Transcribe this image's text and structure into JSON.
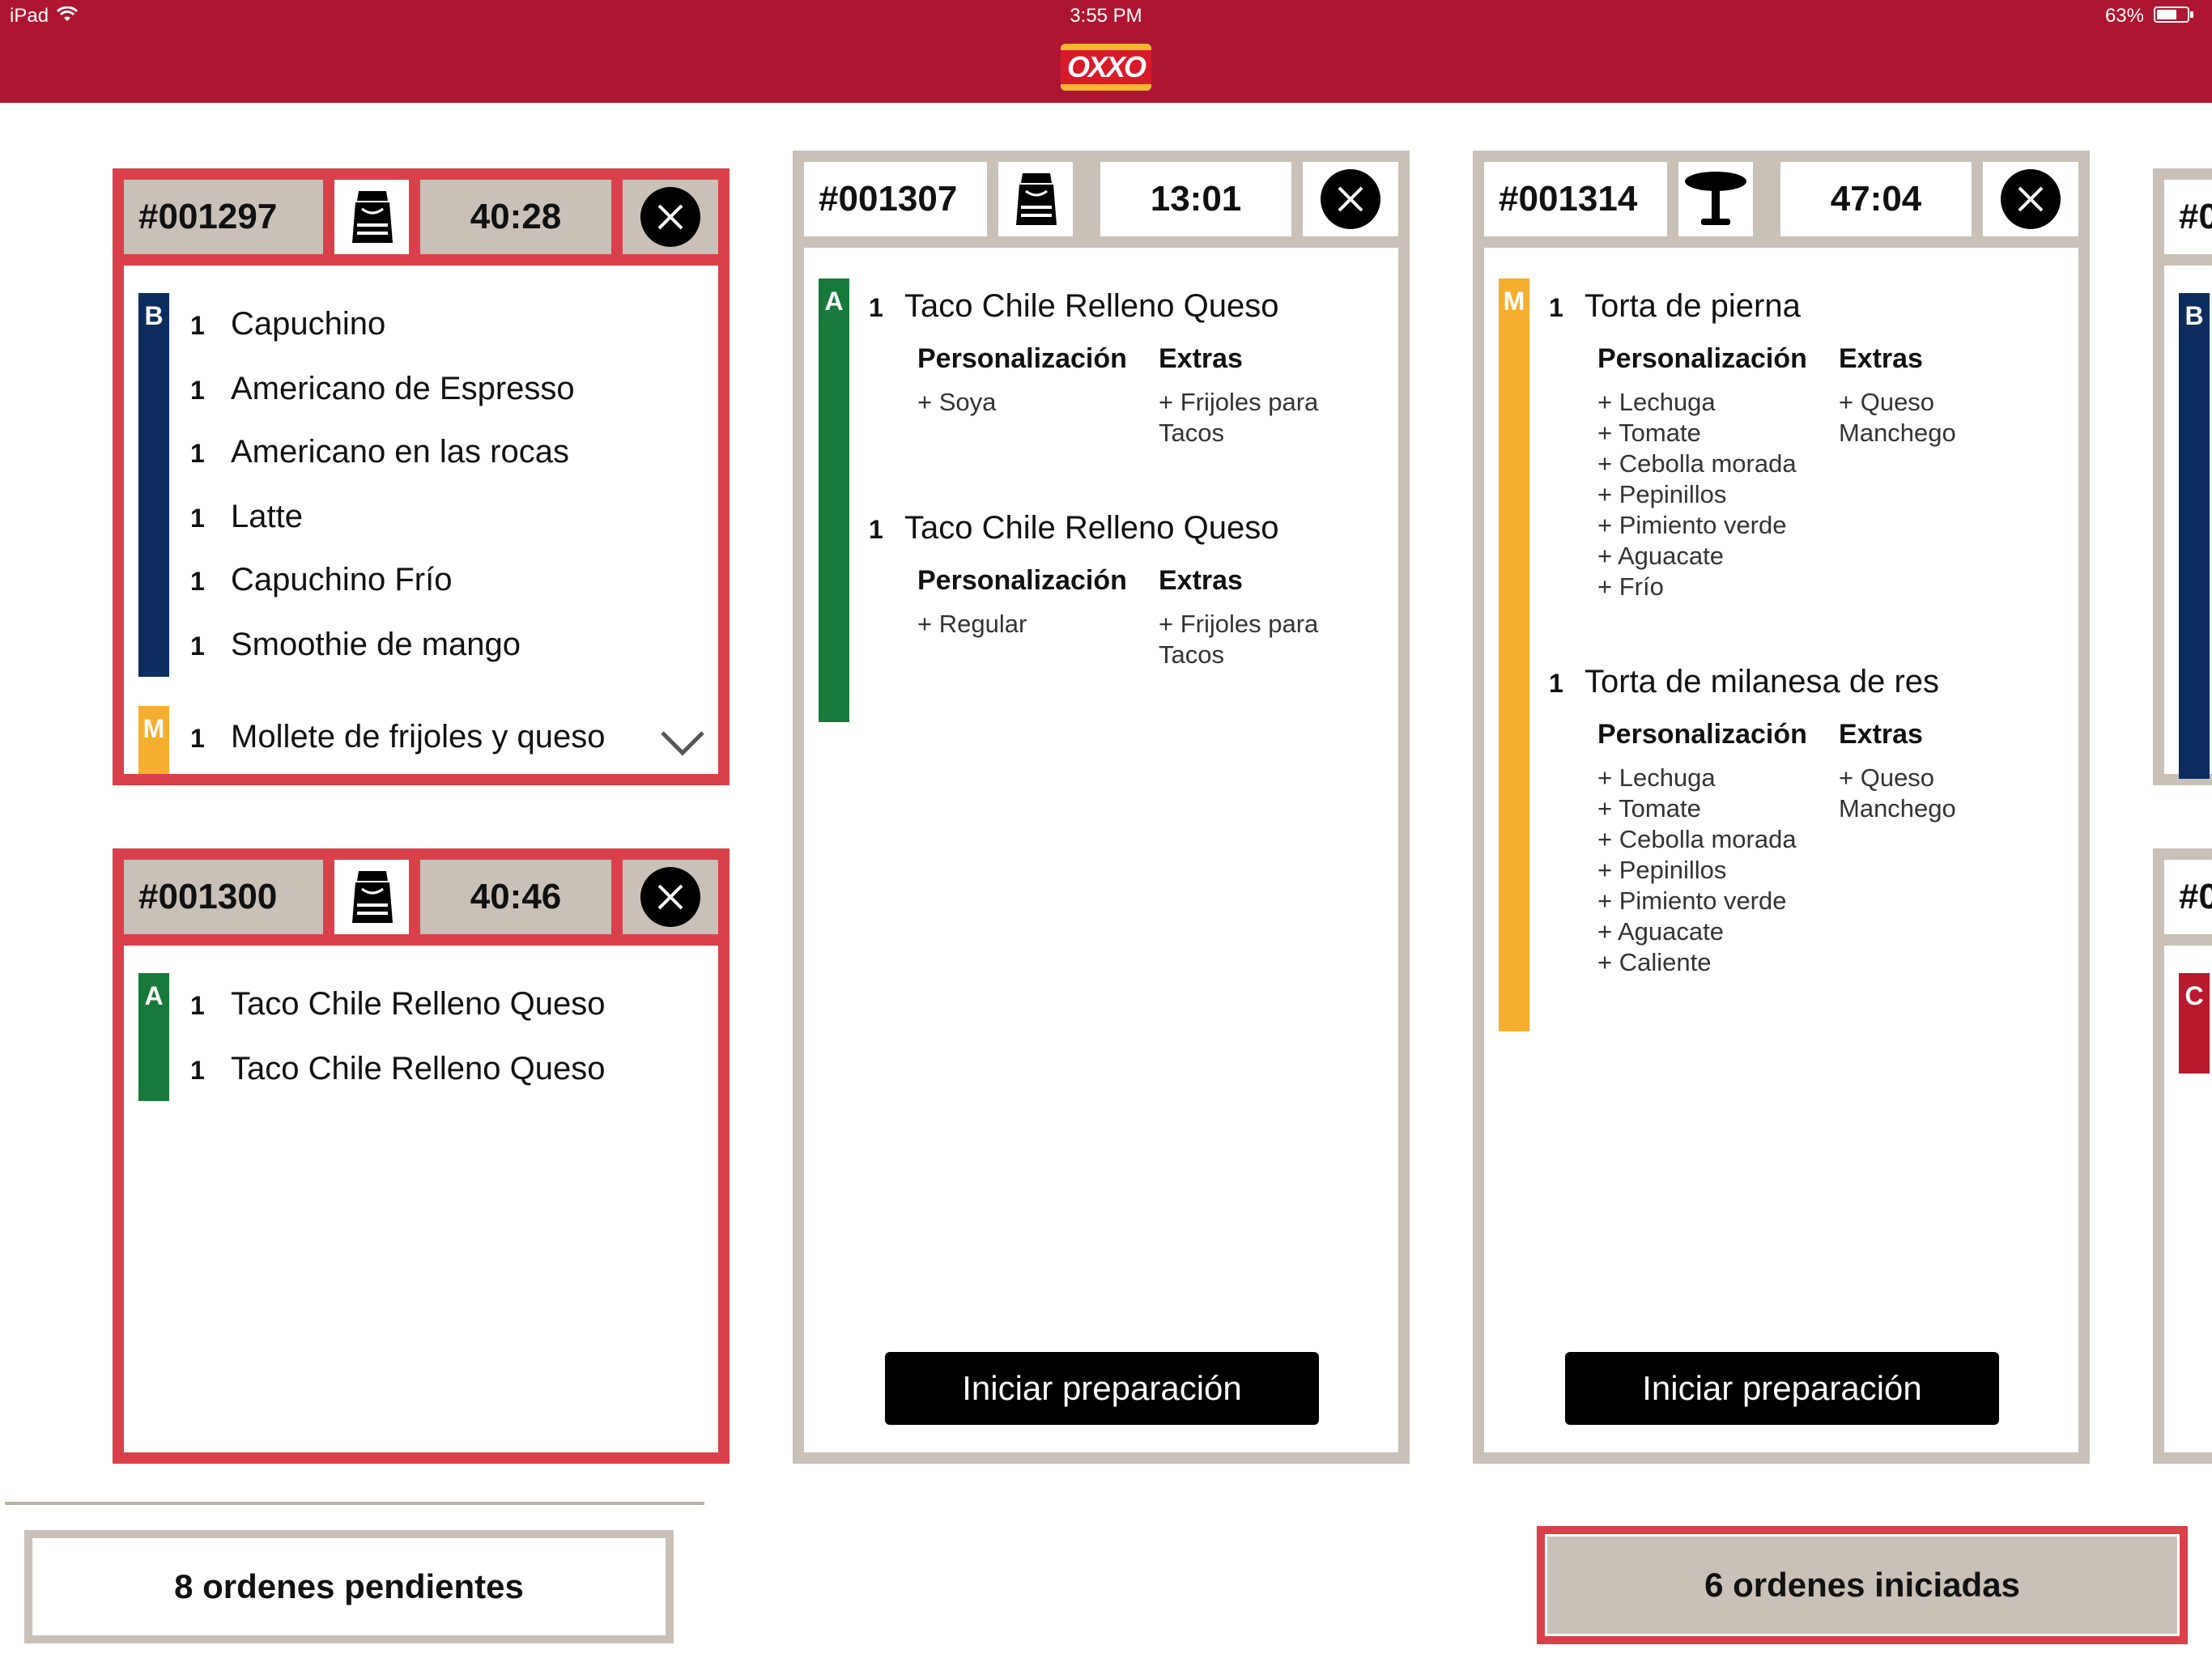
{
  "status_bar": {
    "device": "iPad",
    "time": "3:55 PM",
    "battery": "63%"
  },
  "brand": {
    "logo_text": "OXXO",
    "colors": {
      "header": "#ae1530",
      "alert": "#d9404a",
      "neutral": "#c9c0b7"
    }
  },
  "stations": {
    "B": {
      "label": "B",
      "color": "#0d2d5e"
    },
    "M": {
      "label": "M",
      "color": "#f5ae2f"
    },
    "A": {
      "label": "A",
      "color": "#177a3a"
    },
    "C": {
      "label": "C",
      "color": "#b8192d"
    }
  },
  "orders": [
    {
      "id": "#001297",
      "type_icon": "bag-icon",
      "timer": "40:28",
      "status": "overdue",
      "items": [
        {
          "station": "B",
          "qty": "1",
          "name": "Capuchino"
        },
        {
          "station": "B",
          "qty": "1",
          "name": "Americano de Espresso"
        },
        {
          "station": "B",
          "qty": "1",
          "name": "Americano en las rocas"
        },
        {
          "station": "B",
          "qty": "1",
          "name": "Latte"
        },
        {
          "station": "B",
          "qty": "1",
          "name": "Capuchino Frío"
        },
        {
          "station": "B",
          "qty": "1",
          "name": "Smoothie de mango"
        },
        {
          "station": "M",
          "qty": "1",
          "name": "Mollete de frijoles y queso"
        }
      ]
    },
    {
      "id": "#001300",
      "type_icon": "bag-icon",
      "timer": "40:46",
      "status": "overdue",
      "items": [
        {
          "station": "A",
          "qty": "1",
          "name": "Taco Chile Relleno Queso"
        },
        {
          "station": "A",
          "qty": "1",
          "name": "Taco Chile Relleno Queso"
        }
      ]
    },
    {
      "id": "#001307",
      "type_icon": "bag-icon",
      "timer": "13:01",
      "status": "pending",
      "items": [
        {
          "station": "A",
          "qty": "1",
          "name": "Taco Chile Relleno Queso",
          "personalizacion": "+ Soya",
          "extras": "+ Frijoles para\nTacos"
        },
        {
          "station": "A",
          "qty": "1",
          "name": "Taco Chile Relleno Queso",
          "personalizacion": "+ Regular",
          "extras": "+ Frijoles para\nTacos"
        }
      ],
      "button": "Iniciar preparación"
    },
    {
      "id": "#001314",
      "type_icon": "table-icon",
      "timer": "47:04",
      "status": "pending",
      "items": [
        {
          "station": "M",
          "qty": "1",
          "name": "Torta de pierna",
          "personalizacion": "+ Lechuga\n+ Tomate\n+ Cebolla morada\n+ Pepinillos\n+ Pimiento verde\n+ Aguacate\n+ Frío",
          "extras": "+ Queso\nManchego"
        },
        {
          "station": "M",
          "qty": "1",
          "name": "Torta de milanesa de res",
          "personalizacion": "+ Lechuga\n+ Tomate\n+ Cebolla morada\n+ Pepinillos\n+ Pimiento verde\n+ Aguacate\n+ Caliente",
          "extras": "+ Queso\nManchego"
        }
      ],
      "button": "Iniciar preparación"
    },
    {
      "id": "#0",
      "station_top": "B"
    },
    {
      "id": "#0",
      "station_top": "C"
    }
  ],
  "labels": {
    "personalizacion": "Personalización",
    "extras": "Extras"
  },
  "footer": {
    "pending": "8 ordenes pendientes",
    "started": "6 ordenes iniciadas"
  }
}
